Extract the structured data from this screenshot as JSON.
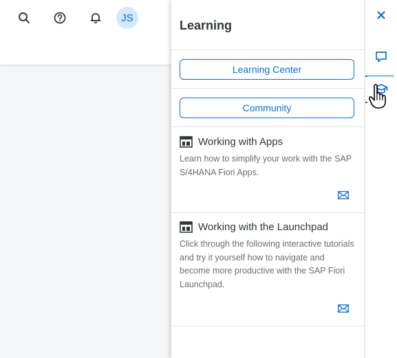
{
  "header": {
    "icons": [
      "search-icon",
      "help-icon",
      "bell-icon"
    ],
    "avatar_initials": "JS"
  },
  "panel": {
    "title": "Learning",
    "buttons": [
      {
        "label": "Learning Center"
      },
      {
        "label": "Community"
      }
    ],
    "cards": [
      {
        "title": "Working with Apps",
        "description": "Learn how to simplify your work with the SAP S/4HANA Fiori Apps.",
        "icon": "tile-icon",
        "action_icon": "mail-icon"
      },
      {
        "title": "Working with the Launchpad",
        "description": "Click through the following interactive tutorials and try it yourself how to navigate and become more productive with the SAP Fiori Launchpad.",
        "icon": "tile-icon",
        "action_icon": "mail-icon"
      }
    ]
  },
  "rail": {
    "icons": [
      "close-icon",
      "chat-icon",
      "learning-icon"
    ],
    "active": "learning-icon"
  },
  "colors": {
    "accent": "#0a6ed1",
    "text": "#32363a",
    "muted": "#6a6d70",
    "avatar_bg": "#d1e8ff"
  }
}
